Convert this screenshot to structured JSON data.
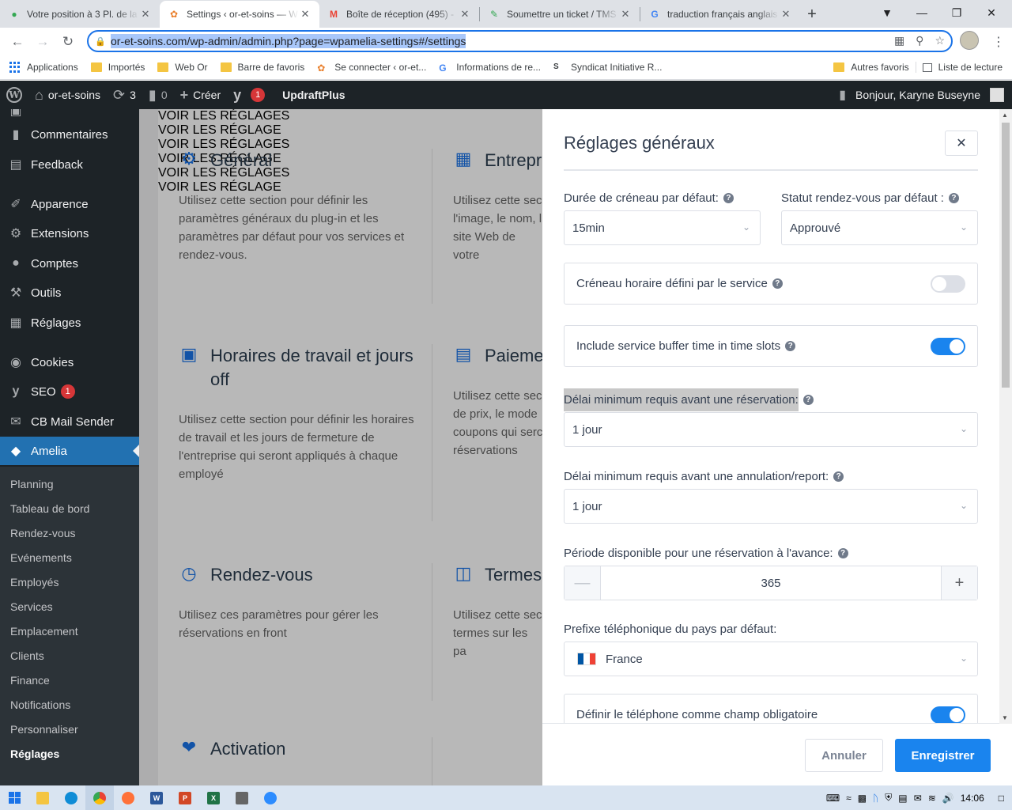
{
  "browser": {
    "tabs": [
      {
        "title": "Votre position à 3 Pl. de la",
        "icon": "maps-pin-icon",
        "color": "#34a853"
      },
      {
        "title": "Settings ‹ or-et-soins — W",
        "icon": "amelia-icon",
        "color": "#e97e2a"
      },
      {
        "title": "Boîte de réception (495) -",
        "icon": "gmail-icon",
        "color": "#ea4335"
      },
      {
        "title": "Soumettre un ticket / TMS",
        "icon": "ticket-icon",
        "color": "#34a853"
      },
      {
        "title": "traduction français anglais",
        "icon": "google-icon",
        "color": "#4285f4"
      }
    ],
    "url": "or-et-soins.com/wp-admin/admin.php?page=wpamelia-settings#/settings",
    "bookmarks": [
      "Applications",
      "Importés",
      "Web Or",
      "Barre de favoris",
      "Se connecter ‹ or-et...",
      "Informations de re...",
      "Syndicat Initiative R...",
      "Autres favoris",
      "Liste de lecture"
    ]
  },
  "adminbar": {
    "site": "or-et-soins",
    "updates": "3",
    "comments": "0",
    "create": "Créer",
    "seo_badge": "1",
    "updraft": "UpdraftPlus",
    "greeting": "Bonjour, Karyne Buseyne"
  },
  "sidebar": {
    "items": [
      "Commentaires",
      "Feedback",
      "Apparence",
      "Extensions",
      "Comptes",
      "Outils",
      "Réglages",
      "Cookies",
      "SEO",
      "CB Mail Sender",
      "Amelia"
    ],
    "seo_badge": "1",
    "submenu": [
      "Planning",
      "Tableau de bord",
      "Rendez-vous",
      "Evénements",
      "Employés",
      "Services",
      "Emplacement",
      "Clients",
      "Finance",
      "Notifications",
      "Personnaliser",
      "Réglages"
    ]
  },
  "cards": {
    "general": {
      "title": "Général",
      "desc": "Utilisez cette section pour définir les paramètres généraux du plug-in et les paramètres par défaut pour vos services et rendez-vous.",
      "link": "VOIR LES RÉGLAGES"
    },
    "entreprise": {
      "title": "Entrepri",
      "desc": "Utilisez cette sec l'image, le nom, l site Web de votre",
      "link": "VOIR LES RÉGLAGE"
    },
    "horaires": {
      "title": "Horaires de travail et jours off",
      "desc": "Utilisez cette section pour définir les horaires de travail et les jours de fermeture de l'entreprise qui seront appliqués à chaque employé",
      "link": "VOIR LES RÉGLAGES"
    },
    "paiements": {
      "title": "Paieme",
      "desc": "Utilisez cette sec de prix, le mode coupons qui serc réservations",
      "link": "VOIR LES RÉGLAGE"
    },
    "rdv": {
      "title": "Rendez-vous",
      "desc": "Utilisez ces paramètres pour gérer les réservations en front",
      "link": "VOIR LES RÉGLAGES"
    },
    "termes": {
      "title": "Termes",
      "desc": "Utilisez cette sec termes sur les pa",
      "link": "VOIR LES RÉGLAGE"
    },
    "activation": {
      "title": "Activation"
    }
  },
  "drawer": {
    "title": "Réglages généraux",
    "slot_label": "Durée de créneau par défaut:",
    "slot_value": "15min",
    "status_label": "Statut rendez-vous par défaut :",
    "status_value": "Approuvé",
    "service_slot_label": "Créneau horaire défini par le service",
    "service_slot_on": false,
    "buffer_label": "Include service buffer time in time slots",
    "buffer_on": true,
    "min_booking_label": "Délai minimum requis avant une réservation:",
    "min_booking_value": "1 jour",
    "min_cancel_label": "Délai minimum requis avant une annulation/report:",
    "min_cancel_value": "1 jour",
    "advance_label": "Période disponible pour une réservation à l'avance:",
    "advance_value": "365",
    "phone_prefix_label": "Prefixe téléphonique du pays par défaut:",
    "phone_prefix_value": "France",
    "phone_required_label": "Définir le téléphone comme champ obligatoire",
    "phone_required_on": true,
    "cancel_btn": "Annuler",
    "save_btn": "Enregistrer"
  },
  "taskbar": {
    "time": "14:06"
  }
}
